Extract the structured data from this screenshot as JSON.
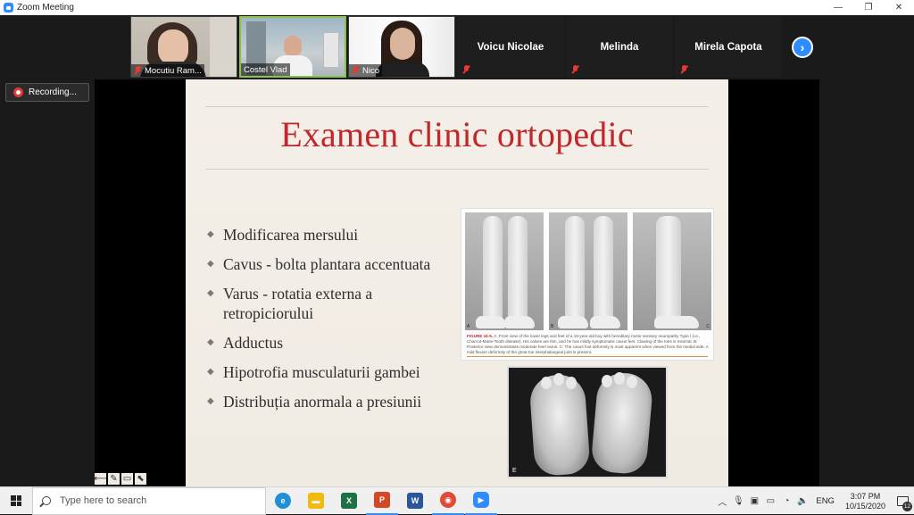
{
  "window": {
    "title": "Zoom Meeting",
    "minimize": "—",
    "restore": "❐",
    "close": "✕"
  },
  "participants": [
    {
      "name": "Mocutiu Ram...",
      "video": true,
      "muted": true
    },
    {
      "name": "Costel Vlad",
      "video": true,
      "muted": false,
      "speaking": true
    },
    {
      "name": "Nico",
      "video": true,
      "muted": true
    },
    {
      "name": "Voicu Nicolae",
      "video": false,
      "muted": true
    },
    {
      "name": "Melinda",
      "video": false,
      "muted": true
    },
    {
      "name": "Mirela Capota",
      "video": false,
      "muted": true
    }
  ],
  "gallery_next": "›",
  "recording": {
    "label": "Recording..."
  },
  "slide": {
    "title": "Examen clinic ortopedic",
    "bullets": [
      "Modificarea mersului",
      "Cavus - bolta plantara accentuata",
      "Varus - rotatia externa a retropiciorului",
      "Adductus",
      "Hipotrofia musculaturii gambei",
      "Distribuția anormala a presiunii"
    ],
    "figure": {
      "panel_labels": [
        "A",
        "B",
        "C"
      ],
      "caption_label": "FIGURE 16-5.",
      "caption": "A: Front view of the lower legs and feet of a 16-year-old boy with hereditary motor sensory neuropathy Type I (i.e., Charcot-Marie-Tooth disease). His calves are thin, and he has mildly symptomatic cavus feet. Clawing of the toes is minimal. B: Posterior view demonstrates moderate heel varus. C: The cavus foot deformity is most apparent when viewed from the medial side. A mild flexion deformity of the great toe interphalangeal joint is present.",
      "bottom_label": "E"
    }
  },
  "annotation_tools": [
    "⟵",
    "✎",
    "▭",
    "⬉"
  ],
  "taskbar": {
    "search_placeholder": "Type here to search",
    "apps": [
      {
        "name": "edge",
        "label": "e",
        "color": "#1f8fd6"
      },
      {
        "name": "file-explorer",
        "label": "▬",
        "color": "#f2b90f"
      },
      {
        "name": "excel",
        "label": "X",
        "color": "#1e7145"
      },
      {
        "name": "powerpoint",
        "label": "P",
        "color": "#d24726"
      },
      {
        "name": "word",
        "label": "W",
        "color": "#2b579a"
      },
      {
        "name": "chrome",
        "label": "◉",
        "color": "#dd4b39"
      },
      {
        "name": "zoom",
        "label": "▶",
        "color": "#2d8cff"
      }
    ],
    "language": "ENG",
    "time": "3:07 PM",
    "date": "10/15/2020",
    "notification_count": "12"
  }
}
